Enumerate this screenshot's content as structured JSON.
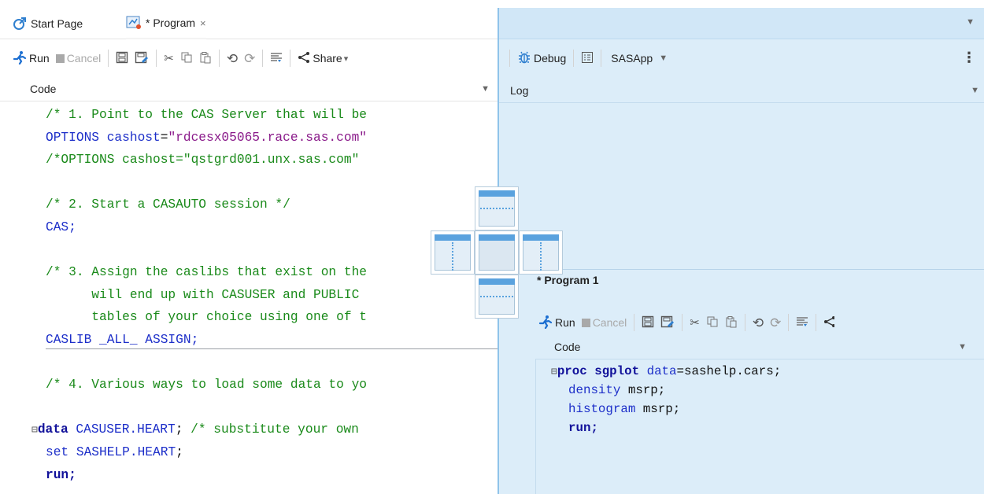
{
  "tabs": [
    {
      "label": "Start Page",
      "icon": "start-page-icon",
      "active": false
    },
    {
      "label": "* Program",
      "icon": "program-icon",
      "active": true,
      "closable": true
    }
  ],
  "left_toolbar": {
    "run": "Run",
    "cancel": "Cancel",
    "share": "Share"
  },
  "right_toolbar": {
    "debug": "Debug",
    "server": "SASApp"
  },
  "left_pane": {
    "header": "Code",
    "code_lines": [
      "/* 1. Point to the CAS Server that will be",
      "OPTIONS cashost=\"rdcesx05065.race.sas.com\"",
      "/*OPTIONS cashost=\"qstgrd001.unx.sas.com\"",
      "",
      "/* 2. Start a CASAUTO session */",
      "CAS;",
      "",
      "/* 3. Assign the caslibs that exist on the",
      "      will end up with CASUSER and PUBLIC",
      "      tables of your choice using one of t",
      "CASLIB _ALL_ ASSIGN;",
      "",
      "/* 4. Various ways to load some data to yo",
      "",
      "data CASUSER.HEART; /* substitute your own",
      "set SASHELP.HEART;",
      "run;"
    ]
  },
  "log_pane": {
    "header": "Log"
  },
  "program1": {
    "title": "* Program 1",
    "run": "Run",
    "cancel": "Cancel",
    "header": "Code",
    "code_lines": [
      "proc sgplot data=sashelp.cars;",
      "density msrp;",
      "histogram msrp;",
      "run;"
    ]
  },
  "colors": {
    "accent": "#5aa2de",
    "panel_bg": "#dcedf9",
    "comment": "#1a8a1a",
    "keyword": "#1d2fc9",
    "string": "#8a1a8a"
  }
}
